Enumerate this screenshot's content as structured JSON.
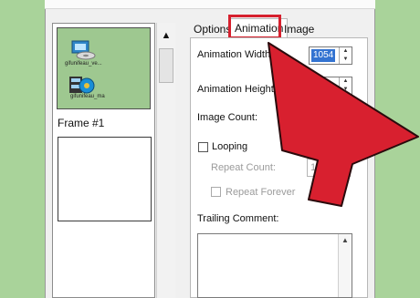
{
  "frames": {
    "frame_label": "Frame #1",
    "thumb_captions": [
      "gifunifeau_ve...",
      "gifunifeau_ma"
    ]
  },
  "tabs": [
    {
      "label": "Options"
    },
    {
      "label": "Animation"
    },
    {
      "label": "Image"
    }
  ],
  "animation": {
    "width_label": "Animation Width:",
    "width_value": "1054",
    "height_label": "Animation Height:",
    "image_count_label": "Image Count:",
    "looping_label": "Looping",
    "repeat_count_label": "Repeat Count:",
    "repeat_count_value": "1",
    "repeat_forever_label": "Repeat Forever",
    "trailing_comment_label": "Trailing Comment:"
  },
  "colors": {
    "highlight": "#d6202e",
    "cursor_fill": "#d8202f",
    "background": "#a9d39a"
  }
}
